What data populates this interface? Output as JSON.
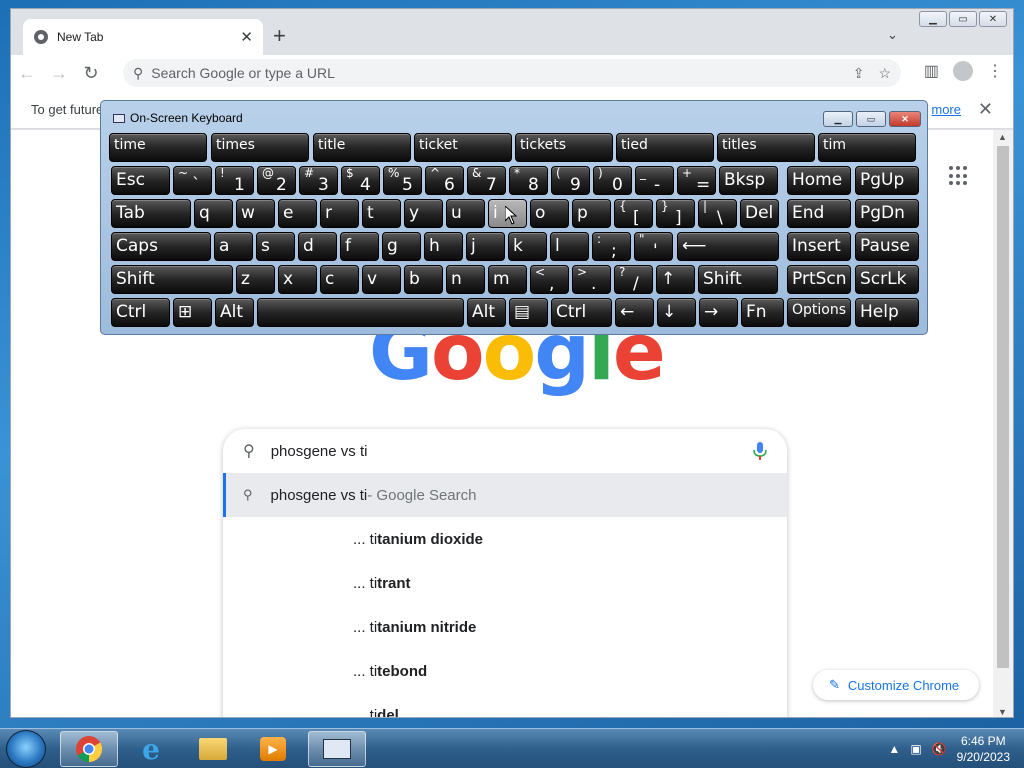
{
  "browser": {
    "tab_title": "New Tab",
    "omnibox_placeholder": "Search Google or type a URL",
    "infobar_text": "To get future",
    "infobar_link": "more",
    "logo_letters": [
      "G",
      "o",
      "o",
      "g",
      "l",
      "e"
    ],
    "logo_colors": [
      "#4285f4",
      "#ea4335",
      "#fbbc05",
      "#4285f4",
      "#34a853",
      "#ea4335"
    ],
    "customize_label": "Customize Chrome"
  },
  "search": {
    "query": "phosgene vs ti",
    "active_suggestion": "phosgene vs ti",
    "active_suffix": " - Google Search",
    "suggestions": [
      {
        "prefix": "... ti",
        "rest": "tanium dioxide"
      },
      {
        "prefix": "... ti",
        "rest": "trant"
      },
      {
        "prefix": "... ti",
        "rest": "tanium nitride"
      },
      {
        "prefix": "... ti",
        "rest": "tebond"
      },
      {
        "prefix": "... ti",
        "rest": "del"
      }
    ]
  },
  "keyboard": {
    "title": "On-Screen Keyboard",
    "predictions": [
      "time",
      "times",
      "title",
      "ticket",
      "tickets",
      "tied",
      "titles",
      "tim"
    ],
    "row1": [
      {
        "t": "Esc"
      },
      {
        "t": "~",
        "b": "`"
      },
      {
        "t": "!",
        "b": "1"
      },
      {
        "t": "@",
        "b": "2"
      },
      {
        "t": "#",
        "b": "3"
      },
      {
        "t": "$",
        "b": "4"
      },
      {
        "t": "%",
        "b": "5"
      },
      {
        "t": "^",
        "b": "6"
      },
      {
        "t": "&",
        "b": "7"
      },
      {
        "t": "*",
        "b": "8"
      },
      {
        "t": "(",
        "b": "9"
      },
      {
        "t": ")",
        "b": "0"
      },
      {
        "t": "_",
        "b": "-"
      },
      {
        "t": "+",
        "b": "="
      },
      {
        "t": "Bksp"
      },
      {
        "t": "Home"
      },
      {
        "t": "PgUp"
      }
    ],
    "row2": [
      "Tab",
      "q",
      "w",
      "e",
      "r",
      "t",
      "y",
      "u",
      "i",
      "o",
      "p",
      {
        "t": "{",
        "b": "["
      },
      {
        "t": "}",
        "b": "]"
      },
      {
        "t": "|",
        "b": "\\"
      },
      "Del",
      "End",
      "PgDn"
    ],
    "row3": [
      "Caps",
      "a",
      "s",
      "d",
      "f",
      "g",
      "h",
      "j",
      "k",
      "l",
      {
        "t": ":",
        "b": ";"
      },
      {
        "t": "\"",
        "b": "'"
      },
      "⟵",
      "Insert",
      "Pause"
    ],
    "row4": [
      "Shift",
      "z",
      "x",
      "c",
      "v",
      "b",
      "n",
      "m",
      {
        "t": "<",
        "b": ","
      },
      {
        "t": ">",
        "b": "."
      },
      {
        "t": "?",
        "b": "/"
      },
      "↑",
      "Shift",
      "PrtScn",
      "ScrLk"
    ],
    "row5": [
      "Ctrl",
      "⊞",
      "Alt",
      "",
      "Alt",
      "▤",
      "Ctrl",
      "←",
      "↓",
      "→",
      "Fn",
      "Options",
      "Help"
    ],
    "hovered_key": "i"
  },
  "taskbar": {
    "time": "6:46 PM",
    "date": "9/20/2023"
  }
}
